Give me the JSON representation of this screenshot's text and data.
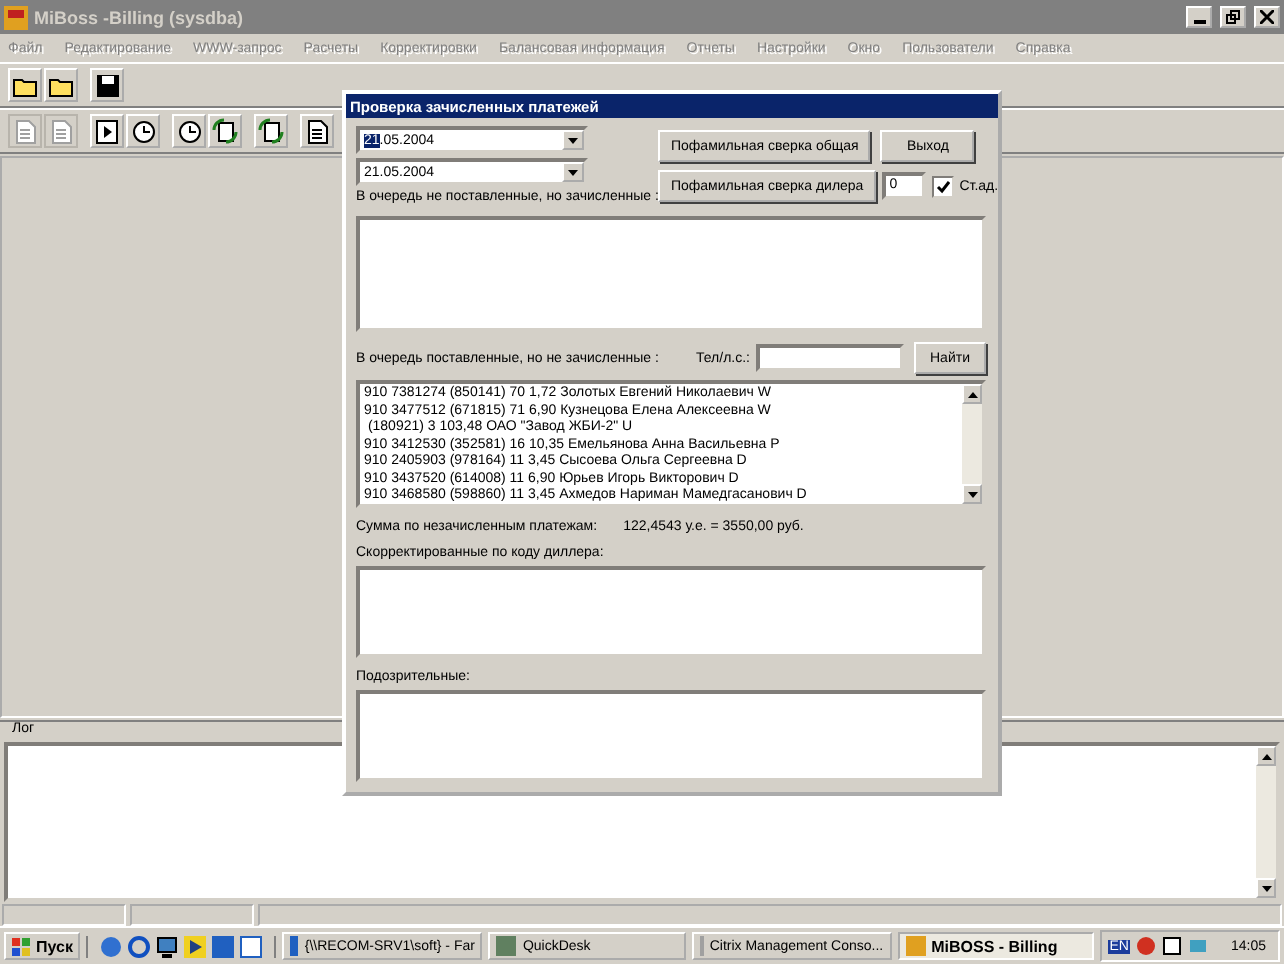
{
  "window": {
    "title": "MiBoss -Billing (sysdba)"
  },
  "menu": [
    {
      "label": "Файл",
      "disabled": true
    },
    {
      "label": "Редактирование",
      "disabled": true
    },
    {
      "label": "WWW-запрос",
      "disabled": true
    },
    {
      "label": "Расчеты",
      "disabled": true
    },
    {
      "label": "Корректировки",
      "disabled": true
    },
    {
      "label": "Балансовая информация",
      "disabled": true
    },
    {
      "label": "Отчеты",
      "disabled": true
    },
    {
      "label": "Настройки",
      "disabled": true
    },
    {
      "label": "Окно",
      "disabled": true
    },
    {
      "label": "Пользователи",
      "disabled": true
    },
    {
      "label": "Справка",
      "disabled": true
    }
  ],
  "toolbars": [
    [
      [
        {
          "kind": "folder",
          "disabled": false
        },
        {
          "kind": "folder",
          "disabled": false
        }
      ],
      [
        {
          "kind": "disk",
          "disabled": false
        }
      ]
    ],
    [
      [
        {
          "kind": "doc",
          "disabled": true
        },
        {
          "kind": "doc",
          "disabled": true
        }
      ],
      [
        {
          "kind": "play",
          "disabled": false
        },
        {
          "kind": "clock",
          "disabled": false
        }
      ],
      [
        {
          "kind": "clock",
          "disabled": false
        },
        {
          "kind": "cycle",
          "disabled": false
        }
      ],
      [
        {
          "kind": "cycle",
          "disabled": false
        }
      ],
      [
        {
          "kind": "doc",
          "disabled": false
        }
      ]
    ]
  ],
  "dialog": {
    "title": "Проверка зачисленных платежей",
    "date_from": {
      "value": "21.05.2004"
    },
    "date_to": {
      "value": "21.05.2004"
    },
    "buttons": {
      "general": "Пофамильная сверка общая",
      "exit": "Выход",
      "dealer": "Пофамильная сверка дилера",
      "find": "Найти"
    },
    "dealer_code": {
      "value": "0"
    },
    "st_ad": {
      "label": "Ст.ад.",
      "checked": true
    },
    "not_queued_label": "В очередь не поставленные, но зачисленные :",
    "queued_label": "В очередь поставленные, но не зачисленные :",
    "phone_label": "Тел/л.с.:",
    "queued_rows": [
      "910 7381274 (850141) 70 1,72 Золотых Евгений Николаевич W",
      "910 3477512 (671815) 71 6,90 Кузнецова Елена Алексеевна W",
      " (180921) 3 103,48 ОАО \"Завод ЖБИ-2\" U",
      "910 3412530 (352581) 16 10,35 Емельянова Анна Васильевна P",
      "910 2405903 (978164) 11 3,45 Сысоева Ольга Сергеевна D",
      "910 3437520 (614008) 11 6,90 Юрьев Игорь Викторович D",
      "910 3468580 (598860) 11 3,45 Ахмедов Нариман Мамедгасанович D"
    ],
    "sum_label": "Сумма по незачисленным платежам:",
    "sum_value": "122,4543 у.е. = 3550,00 руб.",
    "corrected_label": "Скорректированные по коду диллера:",
    "suspicious_label": "Подозрительные:"
  },
  "log": {
    "label": "Лог"
  },
  "taskbar": {
    "start": "Пуск",
    "tasks": [
      {
        "label": "{\\\\RECOM-SRV1\\soft} - Far",
        "selected": false
      },
      {
        "label": "QuickDesk",
        "selected": false
      },
      {
        "label": "Citrix Management Conso...",
        "selected": false
      },
      {
        "label": "MiBOSS - Billing",
        "selected": true
      }
    ],
    "language": "EN",
    "clock": "14:05"
  }
}
